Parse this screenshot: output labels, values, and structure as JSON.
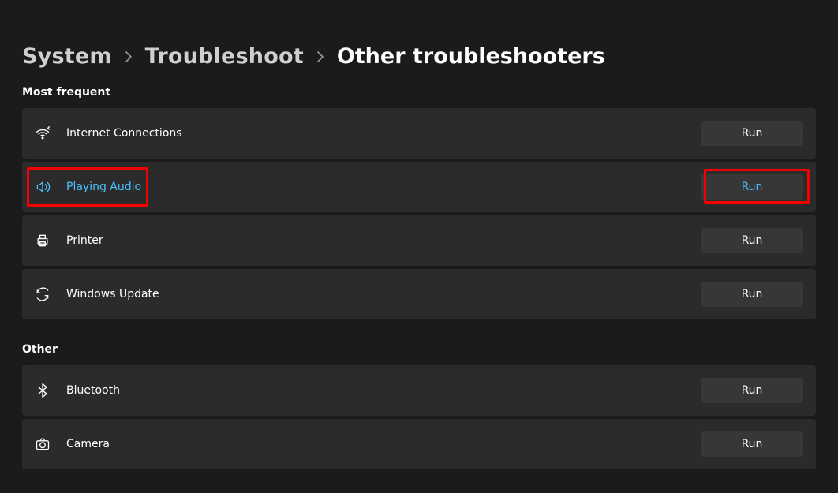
{
  "breadcrumb": {
    "level1": "System",
    "level2": "Troubleshoot",
    "current": "Other troubleshooters"
  },
  "sections": {
    "most_frequent": {
      "label": "Most frequent",
      "items": [
        {
          "icon": "wifi-icon",
          "label": "Internet Connections",
          "button": "Run"
        },
        {
          "icon": "speaker-icon",
          "label": "Playing Audio",
          "button": "Run",
          "highlighted": true
        },
        {
          "icon": "printer-icon",
          "label": "Printer",
          "button": "Run"
        },
        {
          "icon": "sync-icon",
          "label": "Windows Update",
          "button": "Run"
        }
      ]
    },
    "other": {
      "label": "Other",
      "items": [
        {
          "icon": "bluetooth-icon",
          "label": "Bluetooth",
          "button": "Run"
        },
        {
          "icon": "camera-icon",
          "label": "Camera",
          "button": "Run"
        }
      ]
    }
  }
}
